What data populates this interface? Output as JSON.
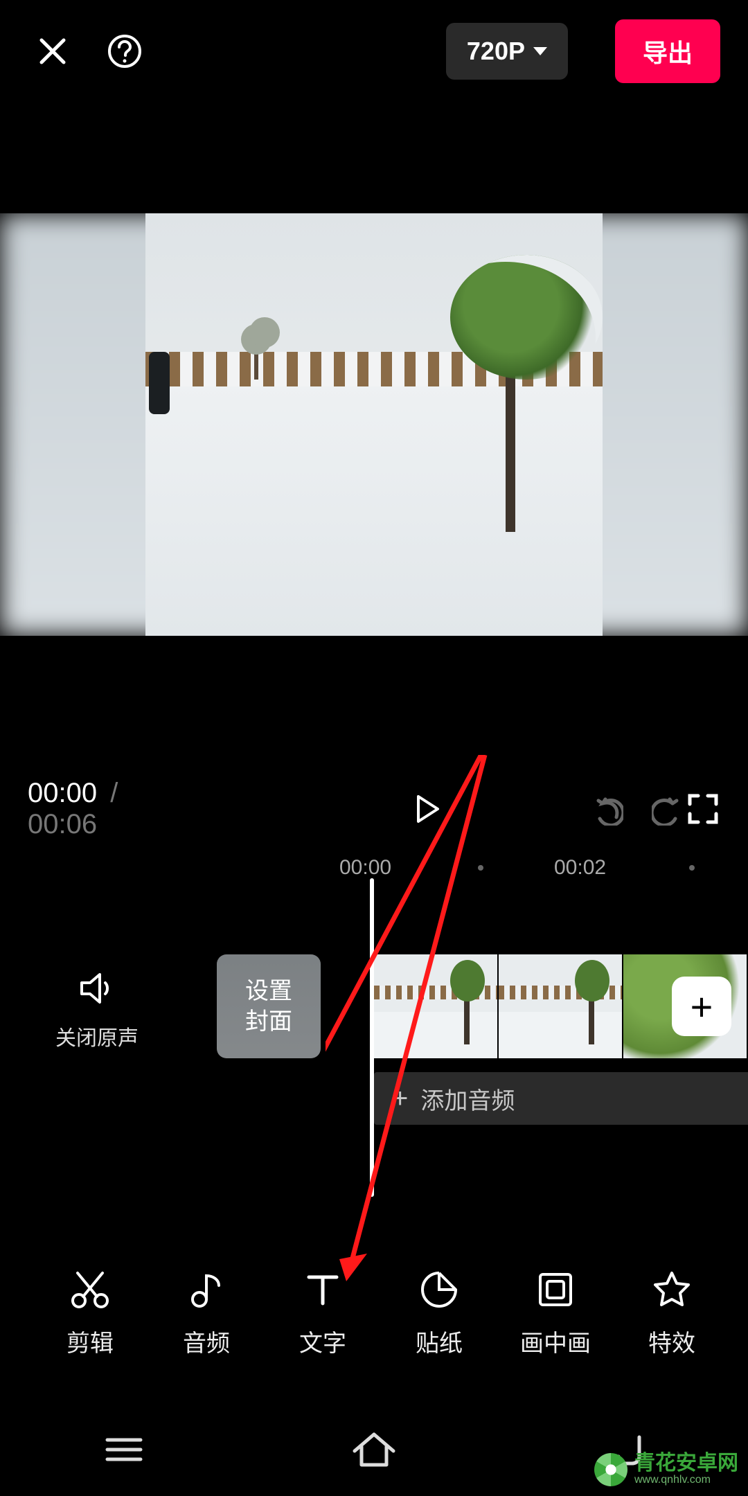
{
  "header": {
    "resolution": "720P",
    "export_label": "导出"
  },
  "playback": {
    "current": "00:00",
    "separator": "/",
    "total": "00:06"
  },
  "ruler": {
    "tick0": "00:00",
    "tick2": "00:02"
  },
  "timeline": {
    "mute_label": "关闭原声",
    "cover_label": "设置\n封面",
    "add_audio_label": "添加音频"
  },
  "tools": [
    {
      "name": "edit",
      "label": "剪辑",
      "icon": "scissors-icon"
    },
    {
      "name": "audio",
      "label": "音频",
      "icon": "music-note-icon"
    },
    {
      "name": "text",
      "label": "文字",
      "icon": "text-icon"
    },
    {
      "name": "sticker",
      "label": "贴纸",
      "icon": "sticker-icon"
    },
    {
      "name": "pip",
      "label": "画中画",
      "icon": "pip-icon"
    },
    {
      "name": "effect",
      "label": "特效",
      "icon": "star-icon"
    }
  ],
  "watermark": {
    "brand": "青花安卓网",
    "url": "www.qnhlv.com"
  },
  "colors": {
    "accent": "#ff0050"
  }
}
